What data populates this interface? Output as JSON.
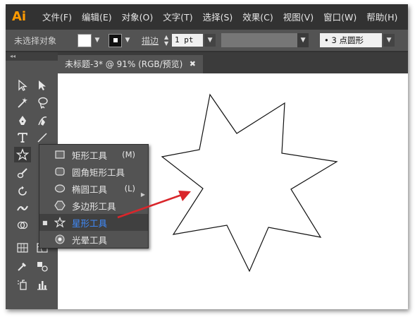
{
  "app": {
    "logo": "Ai"
  },
  "menu": [
    "文件(F)",
    "编辑(E)",
    "对象(O)",
    "文字(T)",
    "选择(S)",
    "效果(C)",
    "视图(V)",
    "窗口(W)",
    "帮助(H)"
  ],
  "control_bar": {
    "selection_status": "未选择对象",
    "stroke_label": "描边",
    "stroke_weight": "1 pt",
    "brush": "• 3 点圆形"
  },
  "document_tab": {
    "title": "未标题-3* @ 91% (RGB/预览)",
    "close_glyph": "✖"
  },
  "tool_flyout": {
    "items": [
      {
        "label": "矩形工具",
        "shortcut": "(M)",
        "icon": "rectangle-icon"
      },
      {
        "label": "圆角矩形工具",
        "shortcut": "",
        "icon": "rounded-rectangle-icon"
      },
      {
        "label": "椭圆工具",
        "shortcut": "(L)",
        "icon": "ellipse-icon"
      },
      {
        "label": "多边形工具",
        "shortcut": "",
        "icon": "polygon-icon"
      },
      {
        "label": "星形工具",
        "shortcut": "",
        "icon": "star-icon",
        "selected": true
      },
      {
        "label": "光晕工具",
        "shortcut": "",
        "icon": "flare-icon"
      }
    ]
  },
  "canvas": {
    "shape": "seven-point-star",
    "annotation_arrow_color": "#d9262b"
  },
  "colors": {
    "accent_selected_text": "#3f8cff",
    "logo": "#ff9a00"
  }
}
